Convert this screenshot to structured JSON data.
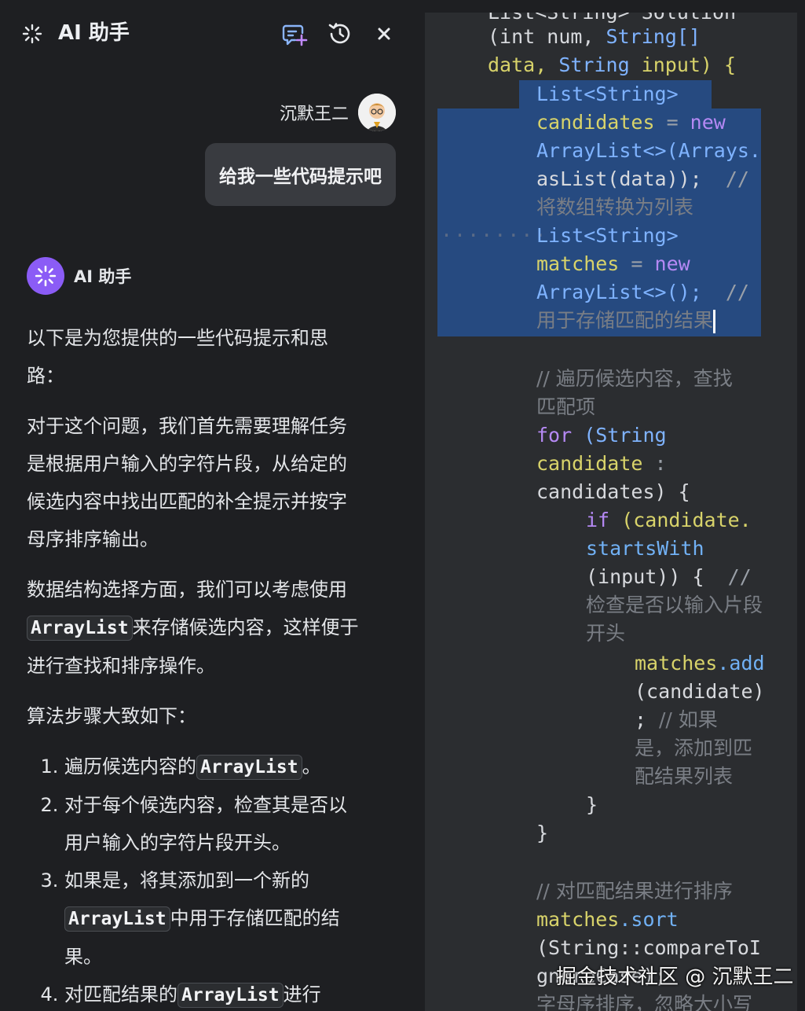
{
  "header": {
    "title": "AI 助手"
  },
  "user": {
    "name": "沉默王二",
    "message": "给我一些代码提示吧"
  },
  "assistant": {
    "name": "AI 助手",
    "p1": "以下是为您提供的一些代码提示和思路：",
    "p2": "对于这个问题，我们首先需要理解任务是根据用户输入的字符片段，从给定的候选内容中找出匹配的补全提示并按字母序排序输出。",
    "p3_a": "数据结构选择方面，我们可以考虑使用",
    "p3_code": "ArrayList",
    "p3_b": "来存储候选内容，这样便于进行查找和排序操作。",
    "p4": "算法步骤大致如下：",
    "steps": [
      {
        "a": "遍历候选内容的",
        "code": "ArrayList",
        "b": "。"
      },
      {
        "a": "对于每个候选内容，检查其是否以用户输入的字符片段开头。",
        "code": "",
        "b": ""
      },
      {
        "a": "如果是，将其添加到一个新的",
        "code": "ArrayList",
        "b": "中用于存储匹配的结果。"
      },
      {
        "a": "对匹配结果的",
        "code": "ArrayList",
        "b": "进行"
      }
    ]
  },
  "code": {
    "l0": "List<String> Solution",
    "l1a": "(int",
    "l1b": " num,",
    "l1c": " String[]",
    "l2a": "data,",
    "l2b": " String",
    "l2c": " input) {",
    "l3": "List<String>",
    "l4a": "candidates",
    "l4b": " = ",
    "l4c": "new",
    "l5": "ArrayList<>(Arrays.",
    "l6a": "asList(data));",
    "l6b": "  //",
    "l7": "将数组转换为列表",
    "l8dots": "········",
    "l8": "List<String>",
    "l9a": "matches",
    "l9b": " = ",
    "l9c": "new",
    "l10a": "ArrayList<>();",
    "l10b": "  //",
    "l11": "用于存储匹配的结果",
    "c1": "// 遍历候选内容，查找",
    "c2": "匹配项",
    "f1a": "for",
    "f1b": " (String",
    "f2a": "candidate",
    "f2b": " :",
    "f3": "candidates) {",
    "i1a": "if",
    "i1b": " (candidate.",
    "i2": "startsWith",
    "i3a": "(input)) {",
    "i3b": "  //",
    "i4": "检查是否以输入片段",
    "i5": "开头",
    "m1a": "matches",
    "m1b": ".add",
    "m2": "(candidate)",
    "m3a": ";",
    "m3b": "  // 如果",
    "m4": "是，添加到匹",
    "m5": "配结果列表",
    "b1": "}",
    "b2": "}",
    "s1": "// 对匹配结果进行排序",
    "s2a": "matches",
    "s2b": ".sort",
    "s3": "(String::compareToI",
    "s4": "gnoreCase);",
    "s5": "字母序排序，忽略大小写"
  },
  "watermark": "掘金技术社区 @ 沉默王二",
  "colors": {
    "panel_bg": "#1e1f22",
    "editor_bg": "#2b2d30",
    "selection": "#264a80",
    "accent_purple": "#8b5cf6",
    "keyword": "#b589f4",
    "type": "#7fb3ff",
    "variable": "#d8d36a",
    "comment": "#7a7e85"
  }
}
